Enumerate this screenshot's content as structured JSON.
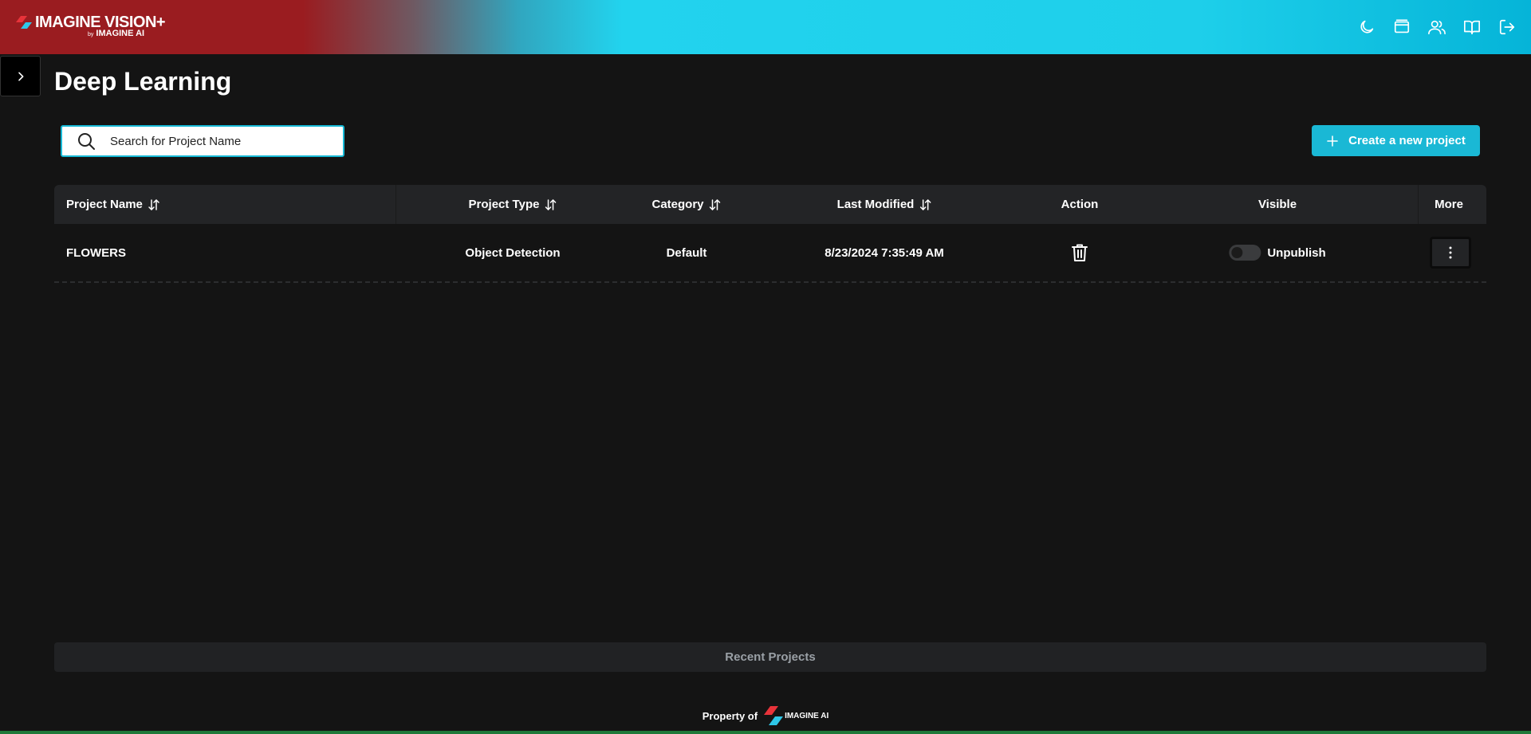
{
  "header": {
    "brand_name": "IMAGINE VISION+",
    "brand_by": "by",
    "brand_company": "IMAGINE AI",
    "icons": [
      "moon-icon",
      "monitor-icon",
      "users-icon",
      "book-open-icon",
      "logout-icon"
    ]
  },
  "page": {
    "title": "Deep Learning"
  },
  "search": {
    "placeholder": "Search for Project Name",
    "value": ""
  },
  "actions": {
    "create_label": "Create a new project"
  },
  "table": {
    "columns": [
      {
        "label": "Project Name",
        "sortable": true
      },
      {
        "label": "Project Type",
        "sortable": true
      },
      {
        "label": "Category",
        "sortable": true
      },
      {
        "label": "Last Modified",
        "sortable": true
      },
      {
        "label": "Action",
        "sortable": false
      },
      {
        "label": "Visible",
        "sortable": false
      },
      {
        "label": "More",
        "sortable": false
      }
    ],
    "rows": [
      {
        "project_name": "FLOWERS",
        "project_type": "Object Detection",
        "category": "Default",
        "last_modified": "8/23/2024 7:35:49 AM",
        "visible_on": false,
        "visible_label": "Unpublish"
      }
    ]
  },
  "recent": {
    "label": "Recent Projects"
  },
  "footer": {
    "property_label": "Property of",
    "logo_text": "IMAGINE AI"
  },
  "colors": {
    "accent": "#1ab8d5",
    "brand_red": "#9a1c20",
    "brand_cyan": "#22d3ee",
    "background": "#141414",
    "header_row": "#232426"
  }
}
